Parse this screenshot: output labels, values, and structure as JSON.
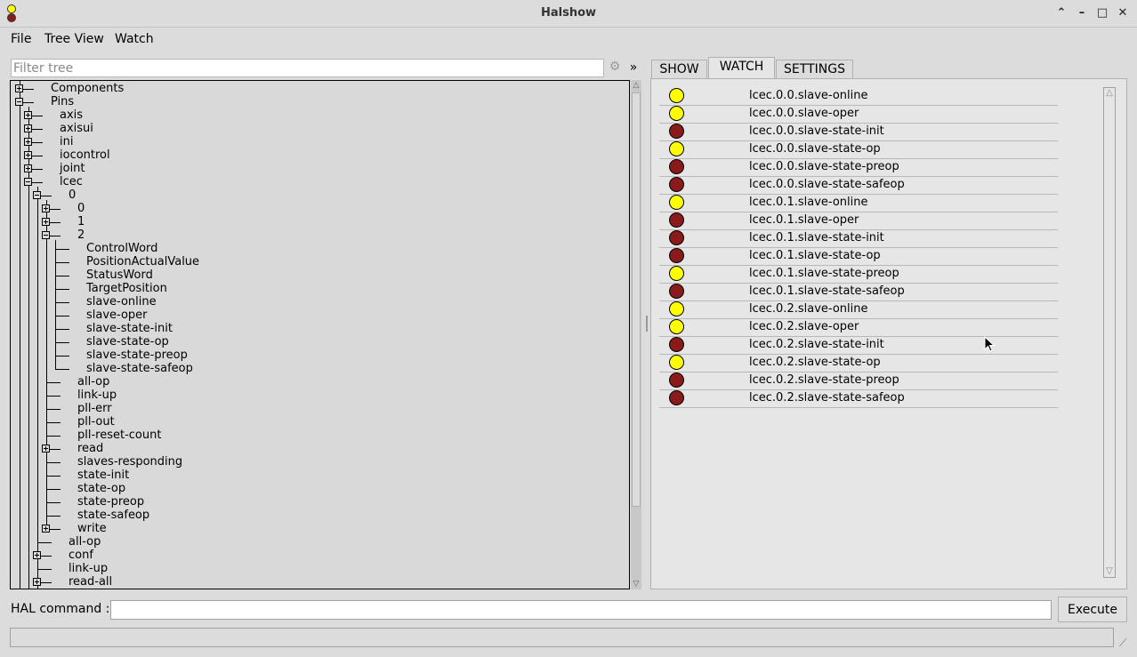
{
  "window": {
    "title": "Halshow"
  },
  "menubar": {
    "file": "File",
    "tree_view": "Tree View",
    "watch": "Watch"
  },
  "filter": {
    "placeholder": "Filter tree",
    "expand": "»"
  },
  "tree": [
    {
      "label": "Components",
      "depth": 0,
      "box": "plus"
    },
    {
      "label": "Pins",
      "depth": 0,
      "box": "minus"
    },
    {
      "label": "axis",
      "depth": 1,
      "box": "plus"
    },
    {
      "label": "axisui",
      "depth": 1,
      "box": "plus"
    },
    {
      "label": "ini",
      "depth": 1,
      "box": "plus"
    },
    {
      "label": "iocontrol",
      "depth": 1,
      "box": "plus"
    },
    {
      "label": "joint",
      "depth": 1,
      "box": "plus"
    },
    {
      "label": "lcec",
      "depth": 1,
      "box": "minus"
    },
    {
      "label": "0",
      "depth": 2,
      "box": "minus"
    },
    {
      "label": "0",
      "depth": 3,
      "box": "plus"
    },
    {
      "label": "1",
      "depth": 3,
      "box": "plus"
    },
    {
      "label": "2",
      "depth": 3,
      "box": "minus"
    },
    {
      "label": "ControlWord",
      "depth": 4,
      "box": ""
    },
    {
      "label": "PositionActualValue",
      "depth": 4,
      "box": ""
    },
    {
      "label": "StatusWord",
      "depth": 4,
      "box": ""
    },
    {
      "label": "TargetPosition",
      "depth": 4,
      "box": ""
    },
    {
      "label": "slave-online",
      "depth": 4,
      "box": ""
    },
    {
      "label": "slave-oper",
      "depth": 4,
      "box": ""
    },
    {
      "label": "slave-state-init",
      "depth": 4,
      "box": ""
    },
    {
      "label": "slave-state-op",
      "depth": 4,
      "box": ""
    },
    {
      "label": "slave-state-preop",
      "depth": 4,
      "box": ""
    },
    {
      "label": "slave-state-safeop",
      "depth": 4,
      "box": ""
    },
    {
      "label": "all-op",
      "depth": 3,
      "box": ""
    },
    {
      "label": "link-up",
      "depth": 3,
      "box": ""
    },
    {
      "label": "pll-err",
      "depth": 3,
      "box": ""
    },
    {
      "label": "pll-out",
      "depth": 3,
      "box": ""
    },
    {
      "label": "pll-reset-count",
      "depth": 3,
      "box": ""
    },
    {
      "label": "read",
      "depth": 3,
      "box": "plus"
    },
    {
      "label": "slaves-responding",
      "depth": 3,
      "box": ""
    },
    {
      "label": "state-init",
      "depth": 3,
      "box": ""
    },
    {
      "label": "state-op",
      "depth": 3,
      "box": ""
    },
    {
      "label": "state-preop",
      "depth": 3,
      "box": ""
    },
    {
      "label": "state-safeop",
      "depth": 3,
      "box": ""
    },
    {
      "label": "write",
      "depth": 3,
      "box": "plus"
    },
    {
      "label": "all-op",
      "depth": 2,
      "box": ""
    },
    {
      "label": "conf",
      "depth": 2,
      "box": "plus"
    },
    {
      "label": "link-up",
      "depth": 2,
      "box": ""
    },
    {
      "label": "read-all",
      "depth": 2,
      "box": "plus"
    }
  ],
  "tabs": [
    "SHOW",
    "WATCH",
    "SETTINGS"
  ],
  "active_tab": "WATCH",
  "watch": [
    {
      "pin": "lcec.0.0.slave-online",
      "state": "on"
    },
    {
      "pin": "lcec.0.0.slave-oper",
      "state": "on"
    },
    {
      "pin": "lcec.0.0.slave-state-init",
      "state": "off"
    },
    {
      "pin": "lcec.0.0.slave-state-op",
      "state": "on"
    },
    {
      "pin": "lcec.0.0.slave-state-preop",
      "state": "off"
    },
    {
      "pin": "lcec.0.0.slave-state-safeop",
      "state": "off"
    },
    {
      "pin": "lcec.0.1.slave-online",
      "state": "on"
    },
    {
      "pin": "lcec.0.1.slave-oper",
      "state": "off"
    },
    {
      "pin": "lcec.0.1.slave-state-init",
      "state": "off"
    },
    {
      "pin": "lcec.0.1.slave-state-op",
      "state": "off"
    },
    {
      "pin": "lcec.0.1.slave-state-preop",
      "state": "on"
    },
    {
      "pin": "lcec.0.1.slave-state-safeop",
      "state": "off"
    },
    {
      "pin": "lcec.0.2.slave-online",
      "state": "on"
    },
    {
      "pin": "lcec.0.2.slave-oper",
      "state": "on"
    },
    {
      "pin": "lcec.0.2.slave-state-init",
      "state": "off"
    },
    {
      "pin": "lcec.0.2.slave-state-op",
      "state": "on"
    },
    {
      "pin": "lcec.0.2.slave-state-preop",
      "state": "off"
    },
    {
      "pin": "lcec.0.2.slave-state-safeop",
      "state": "off"
    }
  ],
  "colors": {
    "led_on": "#ffff00",
    "led_off": "#8b1a1a"
  },
  "hal": {
    "label": "HAL command :",
    "value": "",
    "execute": "Execute"
  }
}
